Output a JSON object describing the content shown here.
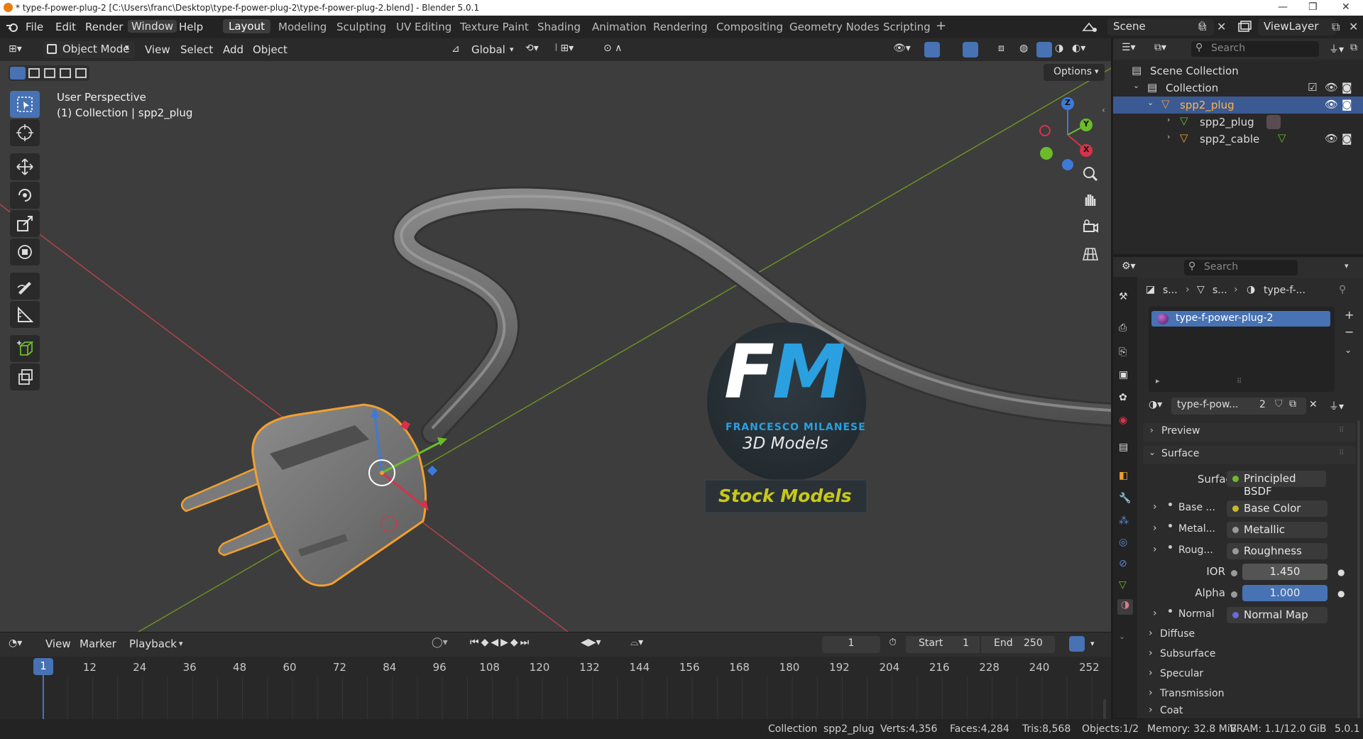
{
  "titlebar": {
    "title": "* type-f-power-plug-2 [C:\\Users\\franc\\Desktop\\type-f-power-plug-2\\type-f-power-plug-2.blend] - Blender 5.0.1",
    "minimize": "—",
    "maximize": "❐",
    "close": "✕"
  },
  "menu": {
    "file": "File",
    "edit": "Edit",
    "render": "Render",
    "window": "Window",
    "help": "Help"
  },
  "workspaces": [
    "Layout",
    "Modeling",
    "Sculpting",
    "UV Editing",
    "Texture Paint",
    "Shading",
    "Animation",
    "Rendering",
    "Compositing",
    "Geometry Nodes",
    "Scripting"
  ],
  "workspace_add": "+",
  "scene": {
    "label": "Scene"
  },
  "viewlayer": {
    "label": "ViewLayer"
  },
  "viewport_header": {
    "mode": "Object Mode",
    "view": "View",
    "select": "Select",
    "add": "Add",
    "object": "Object",
    "transform_orientation": "Global",
    "options": "Options"
  },
  "viewport": {
    "perspective": "User Perspective",
    "collection_info": "(1) Collection | spp2_plug",
    "watermark": {
      "initials_f": "F",
      "initials_m": "M",
      "name": "FRANCESCO MILANESE",
      "subtitle": "3D Models",
      "badge": "Stock Models"
    },
    "gizmo": {
      "z": "Z",
      "y": "Y",
      "x": "X"
    }
  },
  "outliner": {
    "search_placeholder": "Search",
    "scene_collection": "Scene Collection",
    "collection": "Collection",
    "items": [
      {
        "label": "spp2_plug"
      },
      {
        "label": "spp2_plug"
      },
      {
        "label": "spp2_cable"
      }
    ]
  },
  "properties": {
    "search_placeholder": "Search",
    "breadcrumb": {
      "a": "s...",
      "b": "s...",
      "c": "type-f-..."
    },
    "material_slot": "type-f-power-plug-2",
    "material_name": "type-f-pow...",
    "user_count": "2",
    "panels": {
      "preview": "Preview",
      "surface": "Surface",
      "diffuse": "Diffuse",
      "subsurface": "Subsurface",
      "specular": "Specular",
      "transmission": "Transmission",
      "coat": "Coat"
    },
    "surface_label": "Surface",
    "surface_value": "Principled BSDF",
    "inputs": [
      {
        "label": "Base ...",
        "value": "Base Color",
        "dot": "#c9b92a"
      },
      {
        "label": "Metal...",
        "value": "Metallic",
        "dot": "#9a9a9a"
      },
      {
        "label": "Roug...",
        "value": "Roughness",
        "dot": "#9a9a9a"
      }
    ],
    "ior_label": "IOR",
    "ior_value": "1.450",
    "alpha_label": "Alpha",
    "alpha_value": "1.000",
    "normal_label": "Normal",
    "normal_value": "Normal Map"
  },
  "timeline": {
    "view": "View",
    "marker": "Marker",
    "playback": "Playback",
    "current_frame": "1",
    "start_label": "Start",
    "start_value": "1",
    "end_label": "End",
    "end_value": "250",
    "ticks": [
      "12",
      "24",
      "36",
      "48",
      "60",
      "72",
      "84",
      "96",
      "108",
      "120",
      "132",
      "144",
      "156",
      "168",
      "180",
      "192",
      "204",
      "216",
      "228",
      "240",
      "252"
    ],
    "playhead": "1"
  },
  "statusbar": {
    "collection": "Collection",
    "object": "spp2_plug",
    "verts": "Verts:4,356",
    "faces": "Faces:4,284",
    "tris": "Tris:8,568",
    "objects": "Objects:1/2",
    "memory": "Memory: 32.8 MiB",
    "vram": "VRAM: 1.1/12.0 GiB",
    "version": "5.0.1"
  },
  "colors": {
    "accent": "#4772b3",
    "selection_outline": "#f0a030",
    "viewport_bg": "#3d3d3d"
  }
}
